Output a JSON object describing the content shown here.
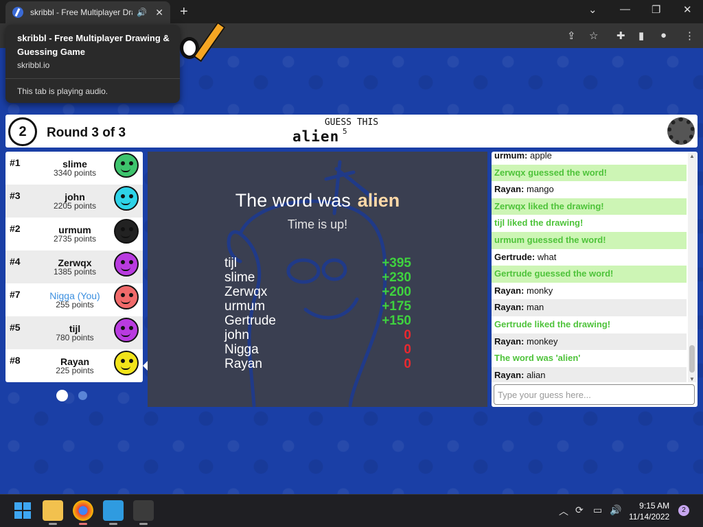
{
  "browser": {
    "tab_title": "skribbl - Free Multiplayer Dra",
    "tooltip_title": "skribbl - Free Multiplayer Drawing & Guessing Game",
    "tooltip_url": "skribbl.io",
    "tooltip_audio": "This tab is playing audio.",
    "icons": [
      "audio-icon",
      "close-icon",
      "new-tab-icon",
      "share-icon",
      "star-icon",
      "extensions-icon",
      "sidebar-icon",
      "profile-icon",
      "menu-icon"
    ]
  },
  "game": {
    "timer": "2",
    "round": "Round 3 of 3",
    "guess_label": "GUESS THIS",
    "word": "alien",
    "word_length": "5"
  },
  "players": [
    {
      "rank": "#1",
      "name": "slime",
      "points": "3340 points",
      "avatar_color": "#3ec46d"
    },
    {
      "rank": "#3",
      "name": "john",
      "points": "2205 points",
      "avatar_color": "#2ed3e8"
    },
    {
      "rank": "#2",
      "name": "urmum",
      "points": "2735 points",
      "avatar_color": "#222222"
    },
    {
      "rank": "#4",
      "name": "Zerwqx",
      "points": "1385 points",
      "avatar_color": "#b93be0"
    },
    {
      "rank": "#7",
      "name": "Nigga (You)",
      "points": "255 points",
      "avatar_color": "#f06a6a"
    },
    {
      "rank": "#5",
      "name": "tijl",
      "points": "780 points",
      "avatar_color": "#b93be0"
    },
    {
      "rank": "#8",
      "name": "Rayan",
      "points": "225 points",
      "avatar_color": "#f2e41a"
    }
  ],
  "speech_bubble": "alian",
  "result": {
    "prefix": "The word was",
    "word": "alien",
    "subtitle": "Time is up!",
    "scores": [
      {
        "name": "tijl",
        "gain": "+395"
      },
      {
        "name": "slime",
        "gain": "+230"
      },
      {
        "name": "Zerwqx",
        "gain": "+200"
      },
      {
        "name": "urmum",
        "gain": "+175"
      },
      {
        "name": "Gertrude",
        "gain": "+150"
      },
      {
        "name": "john",
        "gain": "0"
      },
      {
        "name": "Nigga",
        "gain": "0"
      },
      {
        "name": "Rayan",
        "gain": "0"
      }
    ]
  },
  "chat": {
    "messages": [
      {
        "author": "urmum:",
        "text": "apple"
      },
      {
        "author": "",
        "text": "Zerwqx guessed the word!"
      },
      {
        "author": "Rayan:",
        "text": "mango"
      },
      {
        "author": "",
        "text": "Zerwqx liked the drawing!"
      },
      {
        "author": "",
        "text": "tijl liked the drawing!"
      },
      {
        "author": "",
        "text": "urmum guessed the word!"
      },
      {
        "author": "Gertrude:",
        "text": "what"
      },
      {
        "author": "",
        "text": "Gertrude guessed the word!"
      },
      {
        "author": "Rayan:",
        "text": "monky"
      },
      {
        "author": "Rayan:",
        "text": "man"
      },
      {
        "author": "",
        "text": "Gertrude liked the drawing!"
      },
      {
        "author": "Rayan:",
        "text": "monkey"
      },
      {
        "author": "",
        "text": "The word was 'alien'"
      },
      {
        "author": "Rayan:",
        "text": "alian"
      }
    ],
    "input_placeholder": "Type your guess here..."
  },
  "taskbar": {
    "time": "9:15 AM",
    "date": "11/14/2022",
    "notifications": "2"
  },
  "colors": {
    "page_bg": "#1a3fa6",
    "correct_green": "#4ec33a",
    "zero_red": "#e8292f",
    "revealed_word": "#ffd9a8"
  }
}
